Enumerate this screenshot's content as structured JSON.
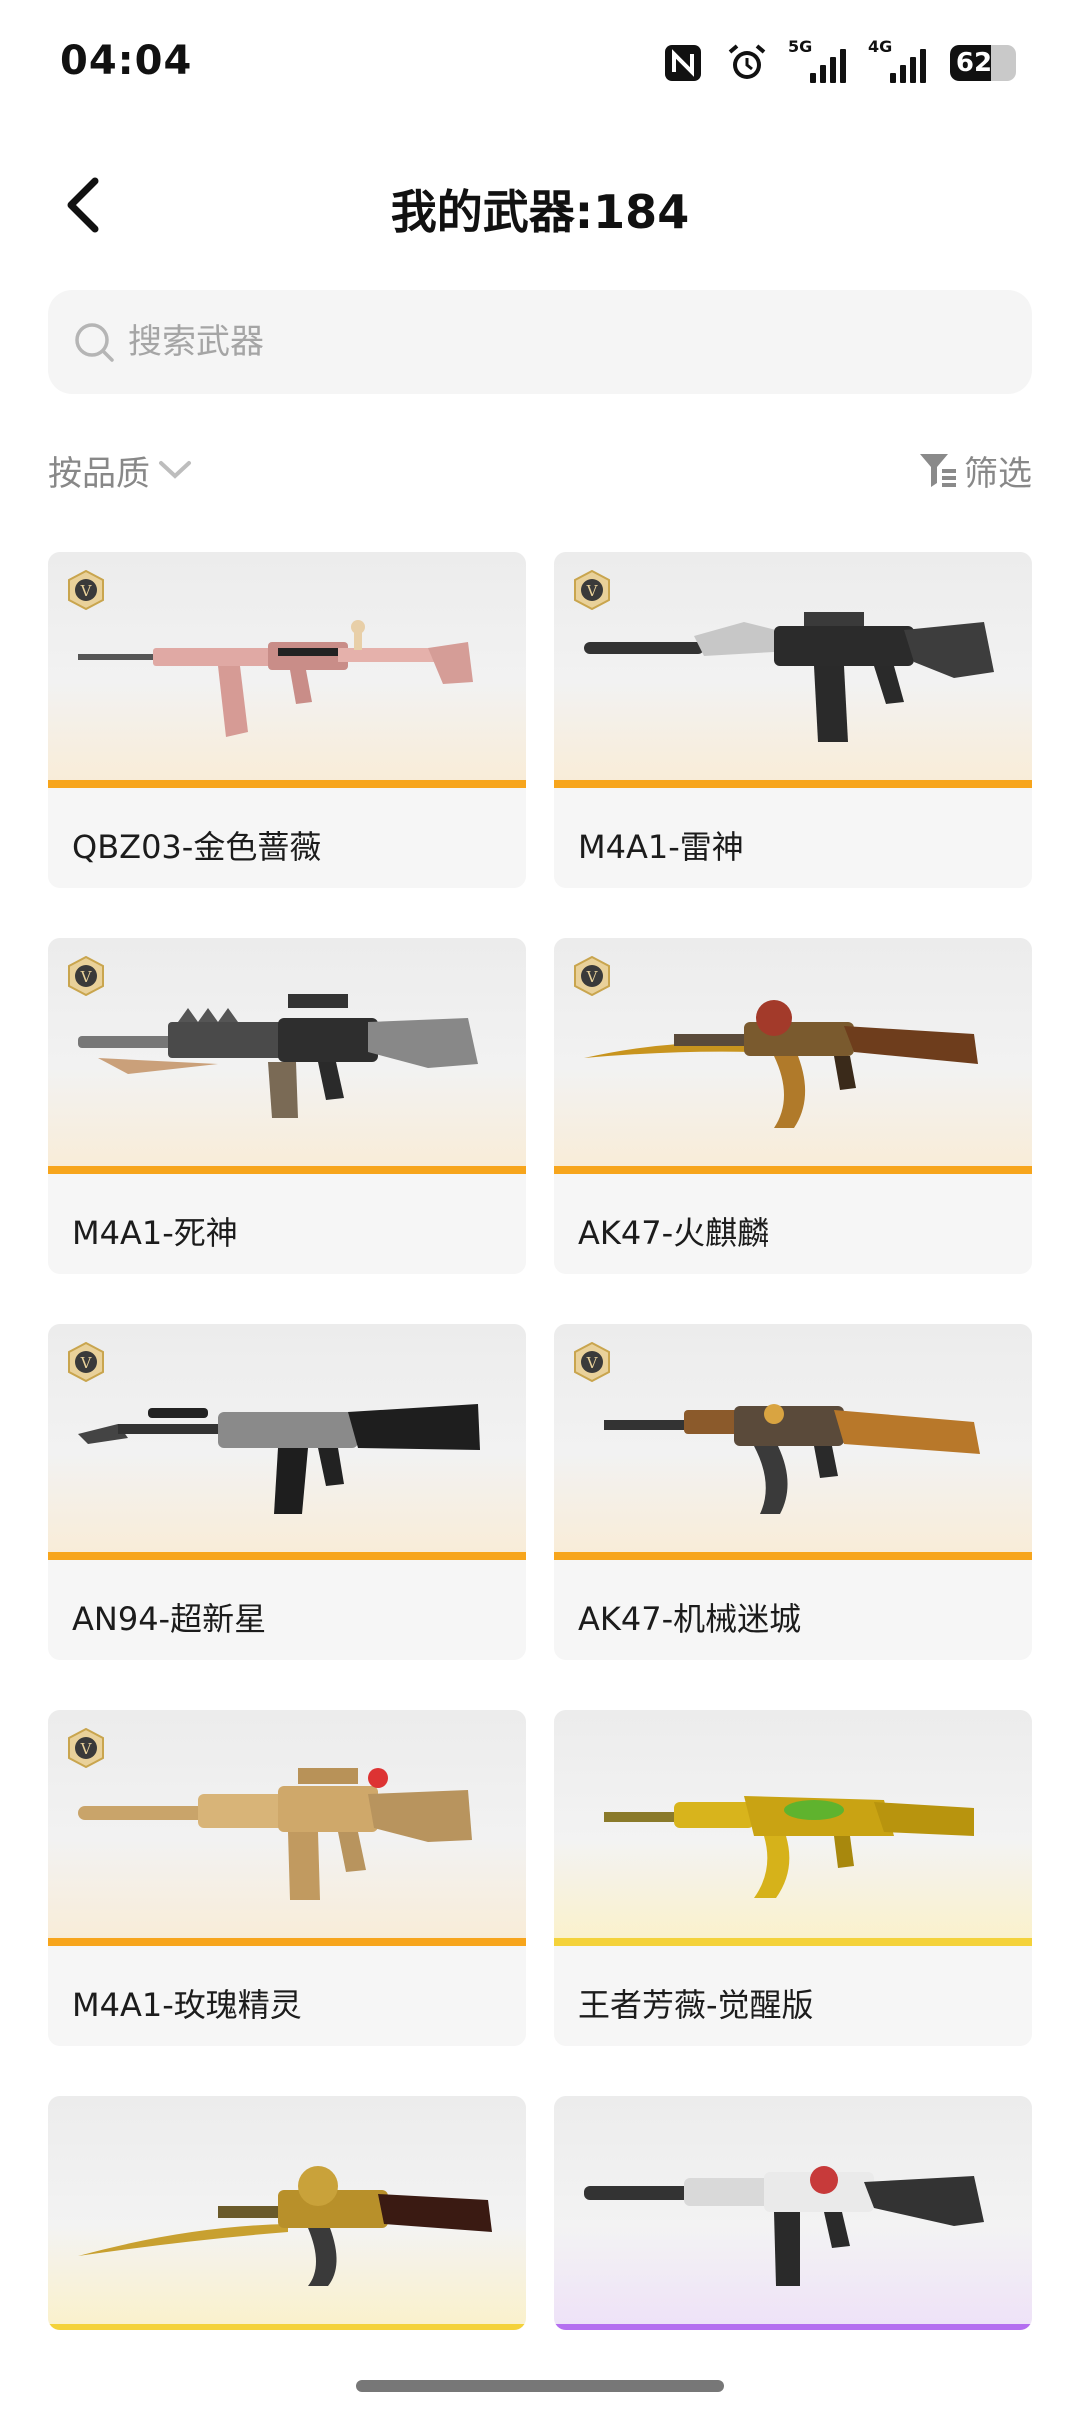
{
  "status_bar": {
    "time": "04:04",
    "signal1_label": "5G",
    "signal2_label": "4G",
    "battery_level": "62",
    "battery_fraction": 0.62,
    "icons": [
      "nfc-icon",
      "alarm-icon",
      "signal-5g-icon",
      "signal-4g-icon",
      "battery-icon"
    ]
  },
  "header": {
    "title": "我的武器:184",
    "back_icon": "back-arrow-icon"
  },
  "search": {
    "placeholder": "搜索武器",
    "value": ""
  },
  "sort": {
    "label": "按品质",
    "icon": "chevron-down-icon"
  },
  "filter": {
    "label": "筛选",
    "icon": "funnel-icon"
  },
  "colors": {
    "orange_tier": "#f7a51c",
    "gold_tier": "#f4d23a",
    "purple_tier": "#b46ff0"
  },
  "weapons": [
    {
      "name": "QBZ03-金色蔷薇",
      "tier": "orange",
      "vip": true
    },
    {
      "name": "M4A1-雷神",
      "tier": "orange",
      "vip": true
    },
    {
      "name": "M4A1-死神",
      "tier": "orange",
      "vip": true
    },
    {
      "name": "AK47-火麒麟",
      "tier": "orange",
      "vip": true
    },
    {
      "name": "AN94-超新星",
      "tier": "orange",
      "vip": true
    },
    {
      "name": "AK47-机械迷城",
      "tier": "orange",
      "vip": true
    },
    {
      "name": "M4A1-玫瑰精灵",
      "tier": "orange",
      "vip": true
    },
    {
      "name": "王者芳薇-觉醒版",
      "tier": "gold",
      "vip": false
    },
    {
      "name": "",
      "tier": "gold",
      "vip": false
    },
    {
      "name": "",
      "tier": "purple",
      "vip": false
    }
  ]
}
